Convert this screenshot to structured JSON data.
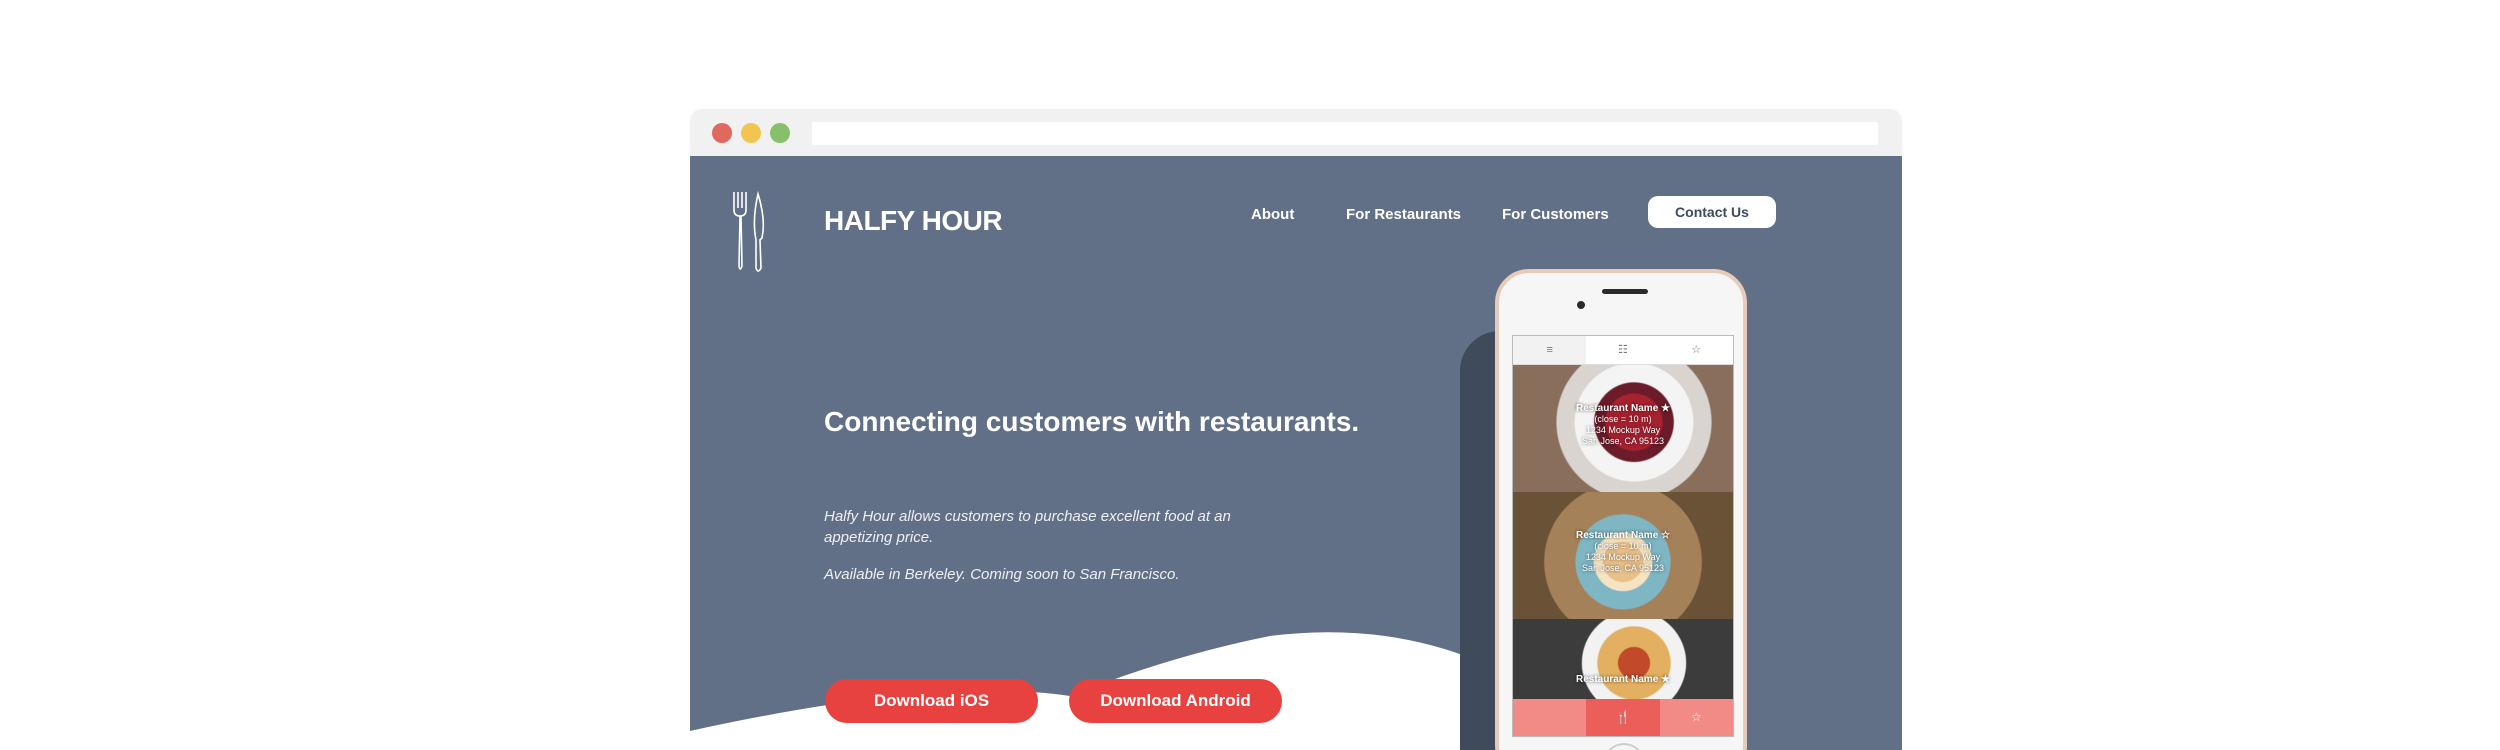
{
  "site": {
    "brand": "HALFY HOUR",
    "nav": {
      "about": "About",
      "restaurants": "For Restaurants",
      "customers": "For Customers",
      "contact": "Contact Us"
    },
    "headline": "Connecting customers with restaurants.",
    "description": "Halfy Hour allows customers to purchase excellent food at an appetizing price.",
    "availability": "Available in Berkeley. Coming soon to San Francisco.",
    "buttons": {
      "ios": "Download iOS",
      "android": "Download Android"
    }
  },
  "phone": {
    "tabs": [
      "≡",
      "☷",
      "☆"
    ],
    "cards": [
      {
        "name": "Restaurant Name ★",
        "distance": "(close = 10 m)",
        "address1": "1234 Mockup Way",
        "address2": "San Jose, CA 95123"
      },
      {
        "name": "Restaurant Name ☆",
        "distance": "(close = 10 m)",
        "address1": "1234 Mockup Way",
        "address2": "San Jose, CA 95123"
      },
      {
        "name": "Restaurant Name ★",
        "distance": "",
        "address1": "",
        "address2": ""
      }
    ],
    "bottom_bar": [
      "",
      "🍴",
      "☆"
    ]
  },
  "colors": {
    "hero_bg": "#627087",
    "accent": "#e84240",
    "white": "#ffffff"
  },
  "icons": [
    "fork-knife-icon",
    "menu-icon",
    "grid-icon",
    "star-icon"
  ]
}
